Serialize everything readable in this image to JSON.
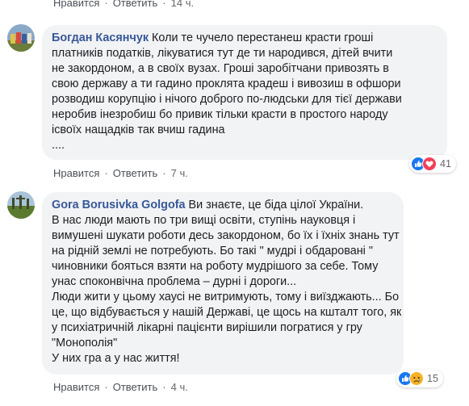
{
  "top_actions": {
    "like": "Нравится",
    "reply": "Ответить",
    "time": "14 ч."
  },
  "comments": [
    {
      "author": "Богдан Касянчук",
      "text_first": "Коли те чучело перестанеш красти гроші",
      "lines": [
        "платників податків, лікуватися тут де ти народився, дітей вчити",
        "не закордоном, а в своїх вузах. Гроші заробітчани привозять в",
        "свою державу а ти гадино проклята крадеш і вивозиш в офшори",
        "розводиш корупцію і нічого доброго по-людськи для тієї держави",
        "неробив інезробиш бо привик тільки красти в простого народу",
        "ісвоїх нащадків так вчиш гадина",
        "...."
      ],
      "reaction_count": "41",
      "reactions": [
        "like-icon",
        "love-icon"
      ],
      "actions": {
        "like": "Нравится",
        "reply": "Ответить",
        "time": "7 ч."
      }
    },
    {
      "author": "Gora Borusivka Golgofa",
      "text_first": "Ви знаєте, це біда цілої України.",
      "lines": [
        "В нас люди мають по три вищі освіти, ступінь науковця і",
        "вимушені шукати роботи десь закордоном, бо їх і їхніх знань тут",
        "на рідній землі не потребують. Бо такі \" мудрі і обдаровані \"",
        "чиновники бояться взяти на роботу мудрішого за себе. Тому",
        "унас споконвічна проблема – дурні і дороги...",
        "Люди жити у цьому хаусі не витримують, тому і виїзджають... Бо",
        "це, що відбувається у нашій Державі, це щось на кшталт того, як",
        "у психіатричній лікарні пацієнти вирішили погратися у гру",
        "\"Монополія\"",
        "У них гра а у нас життя!"
      ],
      "reaction_count": "15",
      "reactions": [
        "like-icon",
        "sad-icon"
      ],
      "actions": {
        "like": "Нравится",
        "reply": "Ответить",
        "time": "4 ч."
      }
    }
  ],
  "colors": {
    "author": "#385898",
    "bubble": "#f2f3f5",
    "action_text": "#4b4f56",
    "like_blue": "#1877f2",
    "love_red": "#f33e58",
    "sad_yellow": "#f7b125"
  }
}
